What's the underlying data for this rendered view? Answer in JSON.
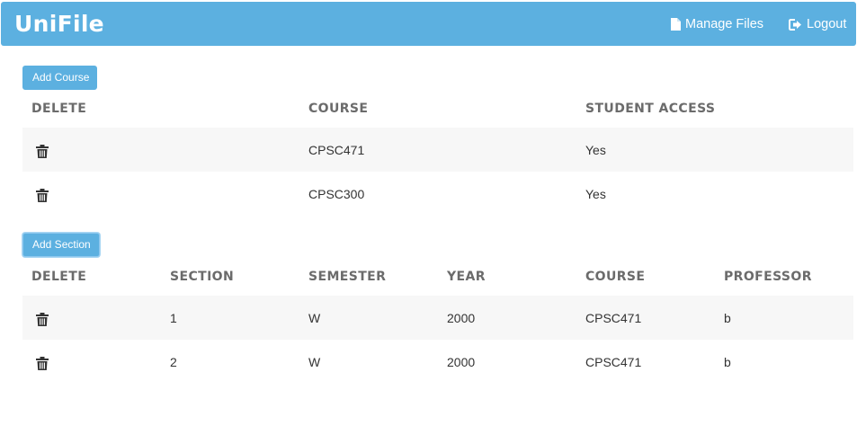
{
  "navbar": {
    "brand": "UniFile",
    "manage_files": "Manage Files",
    "logout": "Logout"
  },
  "courses": {
    "add_button": "Add Course",
    "headers": [
      "DELETE",
      "COURSE",
      "STUDENT ACCESS"
    ],
    "rows": [
      {
        "course": "CPSC471",
        "student_access": "Yes"
      },
      {
        "course": "CPSC300",
        "student_access": "Yes"
      }
    ]
  },
  "sections": {
    "add_button": "Add Section",
    "headers": [
      "DELETE",
      "SECTION",
      "SEMESTER",
      "YEAR",
      "COURSE",
      "PROFESSOR"
    ],
    "rows": [
      {
        "section": "1",
        "semester": "W",
        "year": "2000",
        "course": "CPSC471",
        "professor": "b"
      },
      {
        "section": "2",
        "semester": "W",
        "year": "2000",
        "course": "CPSC471",
        "professor": "b"
      }
    ]
  },
  "colors": {
    "accent": "#5cb0e0",
    "header_text": "#6b6b6b",
    "stripe": "#f7f7f7"
  },
  "icons": {
    "manage_files": "file-icon",
    "logout": "logout-icon",
    "delete": "trash-icon"
  }
}
